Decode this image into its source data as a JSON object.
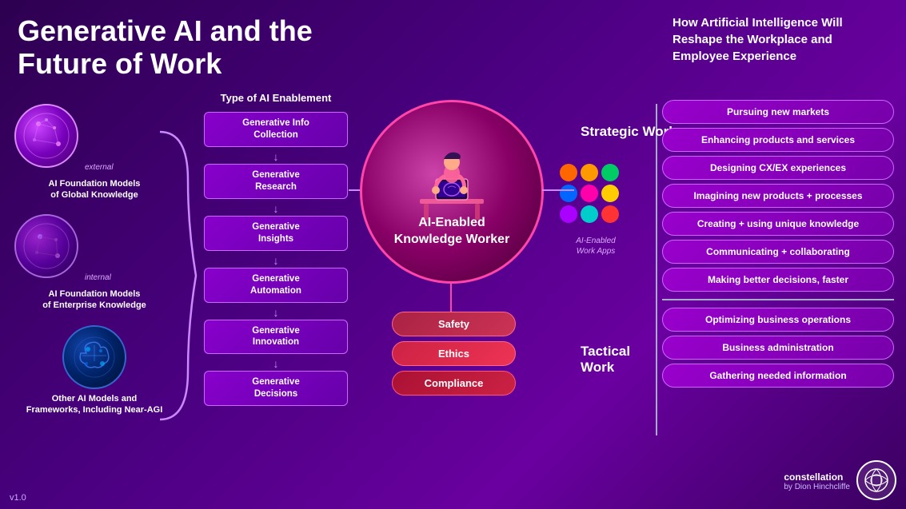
{
  "title": {
    "main_line1": "Generative AI and the",
    "main_line2": "Future of Work"
  },
  "right_header": {
    "text": "How Artificial Intelligence Will\nReshape the Workplace and\nEmployee Experience"
  },
  "left_models": {
    "external_label": "external",
    "internal_label": "internal",
    "model1": {
      "name": "AI Foundation Models\nof Global Knowledge"
    },
    "model2": {
      "name": "AI Foundation Models\nof Enterprise Knowledge"
    },
    "model3": {
      "name": "Other AI Models and\nFrameworks, Including Near-AGI"
    }
  },
  "enablement": {
    "title": "Type of AI Enablement",
    "items": [
      "Generative Info\nCollection",
      "Generative\nResearch",
      "Generative\nInsights",
      "Generative\nAutomation",
      "Generative\nInnovation",
      "Generative\nDecisions"
    ]
  },
  "center": {
    "title": "AI-Enabled\nKnowledge Worker"
  },
  "safety": {
    "safety": "Safety",
    "ethics": "Ethics",
    "compliance": "Compliance"
  },
  "apps_label": "AI-Enabled\nWork Apps",
  "strategic": {
    "title": "Strategic\nWork",
    "tactical": "Tactical\nWork"
  },
  "outcomes": {
    "strategic": [
      "Pursuing new markets",
      "Enhancing products and services",
      "Designing CX/EX experiences",
      "Imagining new products + processes",
      "Creating + using unique knowledge",
      "Communicating + collaborating",
      "Making better decisions, faster"
    ],
    "tactical": [
      "Optimizing business operations",
      "Business administration",
      "Gathering needed information"
    ]
  },
  "version": "v1.0",
  "logo": {
    "name": "constellation",
    "byline": "by Dion Hinchcliffe"
  },
  "dots": [
    "#ff6600",
    "#ff9900",
    "#00cc66",
    "#0066ff",
    "#ff00aa",
    "#ffcc00",
    "#aa00ff",
    "#00cccc",
    "#ff3333"
  ]
}
